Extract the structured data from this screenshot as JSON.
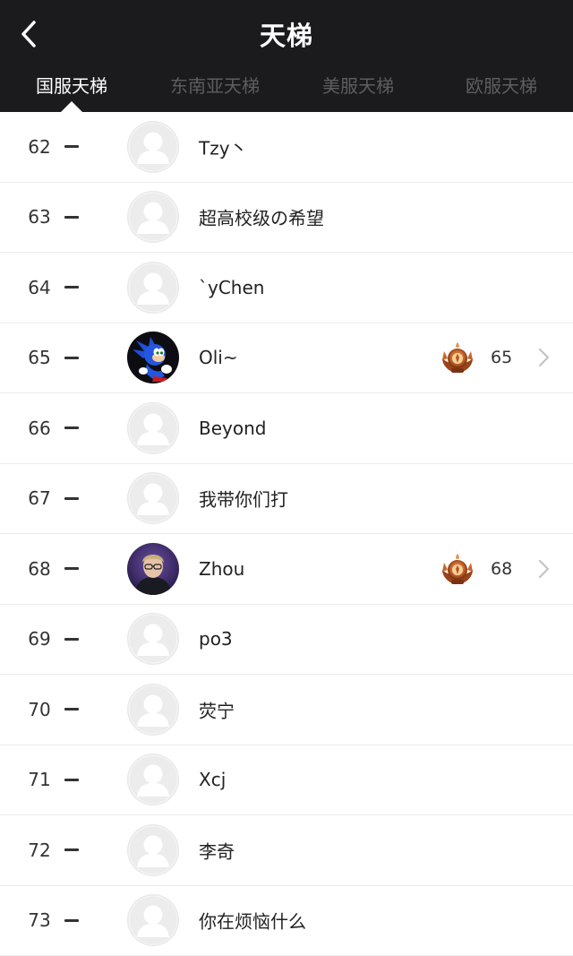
{
  "header": {
    "title": "天梯",
    "back_icon": "chevron-left-icon"
  },
  "tabs": [
    {
      "label": "国服天梯",
      "active": true
    },
    {
      "label": "东南亚天梯",
      "active": false
    },
    {
      "label": "美服天梯",
      "active": false
    },
    {
      "label": "欧服天梯",
      "active": false
    }
  ],
  "colors": {
    "header_bg": "#1b1b1d",
    "tab_inactive": "#5d5d62",
    "tab_active": "#ffffff",
    "row_divider": "#ececec"
  },
  "rows": [
    {
      "rank": "62",
      "change_icon": "dash-icon",
      "avatar": "default-avatar",
      "name": "Tzy丶"
    },
    {
      "rank": "63",
      "change_icon": "dash-icon",
      "avatar": "default-avatar",
      "name": "超高校级の希望"
    },
    {
      "rank": "64",
      "change_icon": "dash-icon",
      "avatar": "default-avatar",
      "name": "`yChen"
    },
    {
      "rank": "65",
      "change_icon": "dash-icon",
      "avatar": "sonic-avatar",
      "name": "Oli~",
      "badge_icon": "rank-medal-icon",
      "level": "65",
      "chevron": "chevron-right-icon"
    },
    {
      "rank": "66",
      "change_icon": "dash-icon",
      "avatar": "default-avatar",
      "name": "Beyond"
    },
    {
      "rank": "67",
      "change_icon": "dash-icon",
      "avatar": "default-avatar",
      "name": "我带你们打"
    },
    {
      "rank": "68",
      "change_icon": "dash-icon",
      "avatar": "photo-avatar",
      "name": "Zhou",
      "badge_icon": "rank-medal-icon",
      "level": "68",
      "chevron": "chevron-right-icon"
    },
    {
      "rank": "69",
      "change_icon": "dash-icon",
      "avatar": "default-avatar",
      "name": "po3"
    },
    {
      "rank": "70",
      "change_icon": "dash-icon",
      "avatar": "default-avatar",
      "name": "荧宁"
    },
    {
      "rank": "71",
      "change_icon": "dash-icon",
      "avatar": "default-avatar",
      "name": "Xcj"
    },
    {
      "rank": "72",
      "change_icon": "dash-icon",
      "avatar": "default-avatar",
      "name": "李奇"
    },
    {
      "rank": "73",
      "change_icon": "dash-icon",
      "avatar": "default-avatar",
      "name": "你在烦恼什么"
    }
  ]
}
